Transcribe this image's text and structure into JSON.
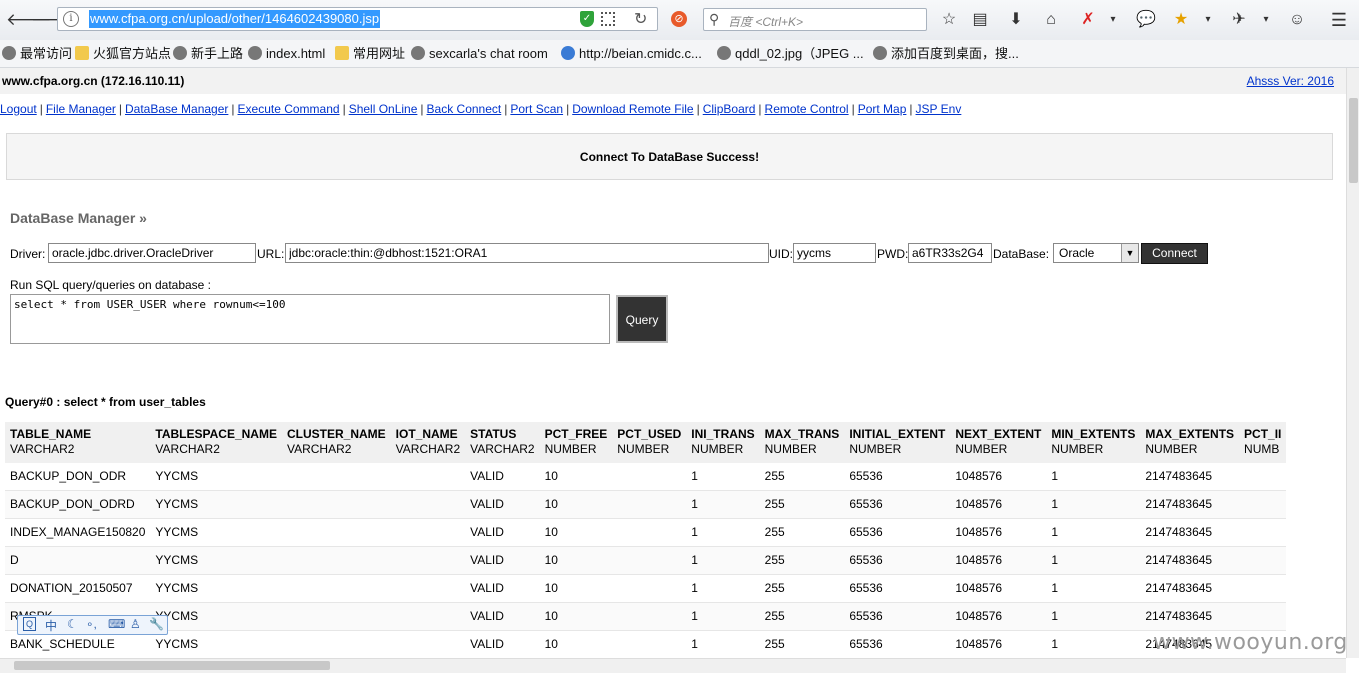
{
  "browser": {
    "url": "www.cfpa.org.cn/upload/other/1464602439080.jsp",
    "search_placeholder": "百度 <Ctrl+K>",
    "bookmarks": [
      {
        "label": "最常访问",
        "icon": "gear-icon"
      },
      {
        "label": "火狐官方站点",
        "icon": "folder-icon"
      },
      {
        "label": "新手上路",
        "icon": "globe-icon"
      },
      {
        "label": "index.html",
        "icon": "globe-icon"
      },
      {
        "label": "常用网址",
        "icon": "folder-icon"
      },
      {
        "label": "sexcarla's chat room",
        "icon": "globe-icon"
      },
      {
        "label": "http://beian.cmidc.c...",
        "icon": "shield-icon"
      },
      {
        "label": "qddl_02.jpg（JPEG ...",
        "icon": "globe-icon"
      },
      {
        "label": "添加百度到桌面，搜...",
        "icon": "globe-icon"
      }
    ]
  },
  "header": {
    "host": "www.cfpa.org.cn (172.16.110.11)",
    "version_link": "Ahsss Ver: 2016"
  },
  "menu": [
    "Logout",
    "File Manager",
    "DataBase Manager",
    "Execute Command",
    "Shell OnLine",
    "Back Connect",
    "Port Scan",
    "Download Remote File",
    "ClipBoard",
    "Remote Control",
    "Port Map",
    "JSP Env"
  ],
  "status_message": "Connect To DataBase Success!",
  "db": {
    "title": "DataBase Manager »",
    "driver_label": "Driver:",
    "driver_value": "oracle.jdbc.driver.OracleDriver",
    "url_label": "URL:",
    "url_value": "jdbc:oracle:thin:@dbhost:1521:ORA1",
    "uid_label": "UID:",
    "uid_value": "yycms",
    "pwd_label": "PWD:",
    "pwd_value": "a6TR33s2G4",
    "database_label": "DataBase:",
    "database_value": "Oracle",
    "connect_button": "Connect",
    "sql_label": "Run SQL query/queries on database :",
    "sql_value": "select * from USER_USER where rownum<=100",
    "query_button": "Query"
  },
  "result": {
    "title": "Query#0 : select * from user_tables",
    "columns": [
      {
        "name": "TABLE_NAME",
        "type": "VARCHAR2"
      },
      {
        "name": "TABLESPACE_NAME",
        "type": "VARCHAR2"
      },
      {
        "name": "CLUSTER_NAME",
        "type": "VARCHAR2"
      },
      {
        "name": "IOT_NAME",
        "type": "VARCHAR2"
      },
      {
        "name": "STATUS",
        "type": "VARCHAR2"
      },
      {
        "name": "PCT_FREE",
        "type": "NUMBER"
      },
      {
        "name": "PCT_USED",
        "type": "NUMBER"
      },
      {
        "name": "INI_TRANS",
        "type": "NUMBER"
      },
      {
        "name": "MAX_TRANS",
        "type": "NUMBER"
      },
      {
        "name": "INITIAL_EXTENT",
        "type": "NUMBER"
      },
      {
        "name": "NEXT_EXTENT",
        "type": "NUMBER"
      },
      {
        "name": "MIN_EXTENTS",
        "type": "NUMBER"
      },
      {
        "name": "MAX_EXTENTS",
        "type": "NUMBER"
      },
      {
        "name": "PCT_II",
        "type": "NUMB"
      }
    ],
    "rows": [
      [
        "BACKUP_DON_ODR",
        "YYCMS",
        "",
        "",
        "VALID",
        "10",
        "",
        "1",
        "255",
        "65536",
        "1048576",
        "1",
        "2147483645",
        ""
      ],
      [
        "BACKUP_DON_ODRD",
        "YYCMS",
        "",
        "",
        "VALID",
        "10",
        "",
        "1",
        "255",
        "65536",
        "1048576",
        "1",
        "2147483645",
        ""
      ],
      [
        "INDEX_MANAGE150820",
        "YYCMS",
        "",
        "",
        "VALID",
        "10",
        "",
        "1",
        "255",
        "65536",
        "1048576",
        "1",
        "2147483645",
        ""
      ],
      [
        "D",
        "YYCMS",
        "",
        "",
        "VALID",
        "10",
        "",
        "1",
        "255",
        "65536",
        "1048576",
        "1",
        "2147483645",
        ""
      ],
      [
        "DONATION_20150507",
        "YYCMS",
        "",
        "",
        "VALID",
        "10",
        "",
        "1",
        "255",
        "65536",
        "1048576",
        "1",
        "2147483645",
        ""
      ],
      [
        "RMSPK",
        "YYCMS",
        "",
        "",
        "VALID",
        "10",
        "",
        "1",
        "255",
        "65536",
        "1048576",
        "1",
        "2147483645",
        ""
      ],
      [
        "BANK_SCHEDULE",
        "YYCMS",
        "",
        "",
        "VALID",
        "10",
        "",
        "1",
        "255",
        "65536",
        "1048576",
        "1",
        "2147483645",
        ""
      ]
    ]
  },
  "ime_toolbar": {
    "mode": "中"
  },
  "watermark": "www.wooyun.org"
}
